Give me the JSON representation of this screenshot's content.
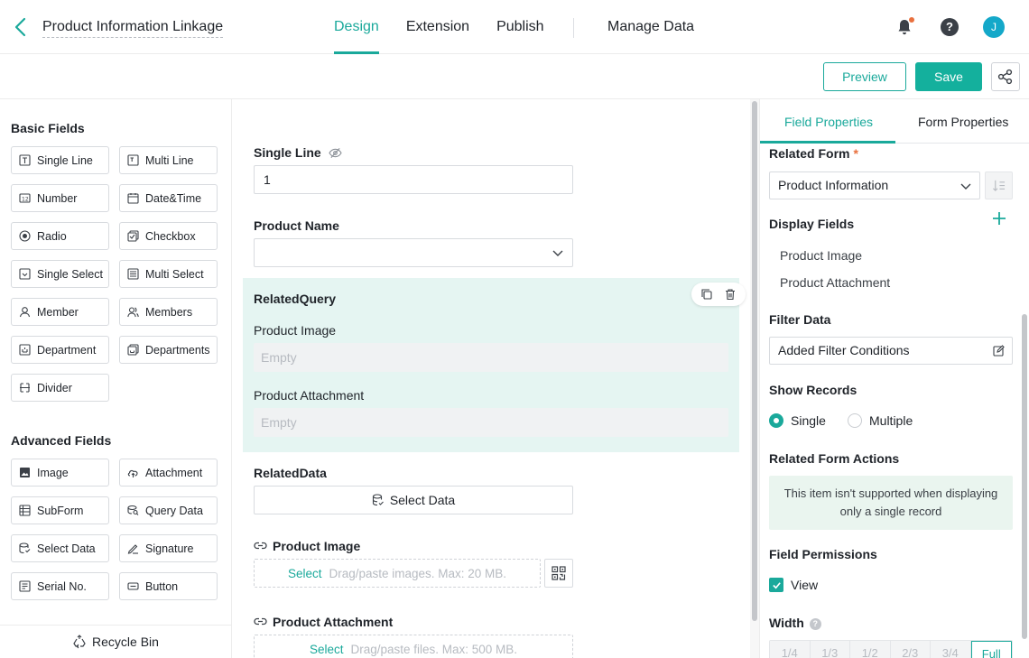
{
  "header": {
    "title": "Product Information Linkage",
    "tabs": [
      {
        "label": "Design",
        "active": true
      },
      {
        "label": "Extension"
      },
      {
        "label": "Publish"
      }
    ],
    "manage_data": "Manage Data",
    "help": "?",
    "avatar": "J",
    "accent": "#1aa99b"
  },
  "toolbar": {
    "preview": "Preview",
    "save": "Save"
  },
  "palette": {
    "basic_title": "Basic Fields",
    "basic": [
      {
        "label": "Single Line",
        "icon": "single-line-icon"
      },
      {
        "label": "Multi Line",
        "icon": "multi-line-icon"
      },
      {
        "label": "Number",
        "icon": "number-icon"
      },
      {
        "label": "Date&Time",
        "icon": "calendar-icon"
      },
      {
        "label": "Radio",
        "icon": "radio-icon"
      },
      {
        "label": "Checkbox",
        "icon": "checkbox-icon"
      },
      {
        "label": "Single Select",
        "icon": "single-select-icon"
      },
      {
        "label": "Multi Select",
        "icon": "multi-select-icon"
      },
      {
        "label": "Member",
        "icon": "member-icon"
      },
      {
        "label": "Members",
        "icon": "members-icon"
      },
      {
        "label": "Department",
        "icon": "department-icon"
      },
      {
        "label": "Departments",
        "icon": "departments-icon"
      },
      {
        "label": "Divider",
        "icon": "divider-icon"
      }
    ],
    "advanced_title": "Advanced Fields",
    "advanced": [
      {
        "label": "Image",
        "icon": "image-icon"
      },
      {
        "label": "Attachment",
        "icon": "attachment-icon"
      },
      {
        "label": "SubForm",
        "icon": "subform-icon"
      },
      {
        "label": "Query Data",
        "icon": "query-data-icon"
      },
      {
        "label": "Select Data",
        "icon": "select-data-icon"
      },
      {
        "label": "Signature",
        "icon": "signature-icon"
      },
      {
        "label": "Serial No.",
        "icon": "serial-number-icon"
      },
      {
        "label": "Button",
        "icon": "button-icon"
      }
    ],
    "recycle_bin": "Recycle Bin"
  },
  "canvas": {
    "single_line": {
      "label": "Single Line",
      "value": "1"
    },
    "product_name": {
      "label": "Product Name",
      "value": ""
    },
    "related_query": {
      "title": "RelatedQuery",
      "fields": [
        {
          "label": "Product Image",
          "value": "Empty"
        },
        {
          "label": "Product Attachment",
          "value": "Empty"
        }
      ]
    },
    "related_data": {
      "label": "RelatedData",
      "button": "Select Data"
    },
    "product_image": {
      "label": "Product Image",
      "select": "Select",
      "hint": "Drag/paste images. Max: 20 MB."
    },
    "product_attachment": {
      "label": "Product Attachment",
      "select": "Select",
      "hint": "Drag/paste files. Max: 500 MB."
    }
  },
  "properties": {
    "tabs": [
      {
        "label": "Field Properties",
        "active": true
      },
      {
        "label": "Form Properties"
      }
    ],
    "related_form_label": "Related Form",
    "required_mark": "*",
    "related_form_value": "Product Information",
    "display_fields_label": "Display Fields",
    "display_fields": [
      "Product Image",
      "Product Attachment"
    ],
    "filter_label": "Filter Data",
    "filter_value": "Added Filter Conditions",
    "show_records_label": "Show Records",
    "show_records_options": [
      {
        "label": "Single",
        "selected": true
      },
      {
        "label": "Multiple",
        "selected": false
      }
    ],
    "actions_label": "Related Form Actions",
    "actions_note": "This item isn't supported when displaying only a single record",
    "permissions_label": "Field Permissions",
    "permission_view": "View",
    "width_label": "Width",
    "width_info": "?",
    "widths": [
      "1/4",
      "1/3",
      "1/2",
      "2/3",
      "3/4",
      "Full"
    ],
    "width_selected": "Full"
  }
}
